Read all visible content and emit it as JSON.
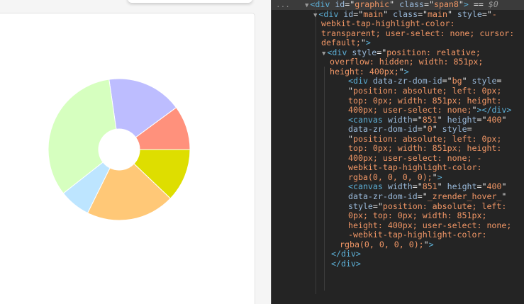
{
  "chart_data": {
    "type": "pie",
    "values": [
      10,
      17,
      33,
      7,
      20,
      12
    ],
    "colors": [
      "#ff917c",
      "#bdbdff",
      "#d6ffbf",
      "#bde5ff",
      "#ffc877",
      "#dede00"
    ],
    "inner_radius_ratio": 0.29,
    "start_angle_deg": 0,
    "direction": "counterclockwise"
  },
  "devtools": {
    "dots": "...",
    "lines": [
      {
        "name": "dt-line-graphic",
        "arrow": "▼",
        "parts": [
          {
            "c": "tag",
            "t": "<div "
          },
          {
            "c": "an",
            "t": "id"
          },
          {
            "c": "eq",
            "t": "=\""
          },
          {
            "c": "av",
            "t": "graphic"
          },
          {
            "c": "eq",
            "t": "\" "
          },
          {
            "c": "an",
            "t": "class"
          },
          {
            "c": "eq",
            "t": "=\""
          },
          {
            "c": "av",
            "t": "span8"
          },
          {
            "c": "eq",
            "t": "\""
          },
          {
            "c": "tag",
            "t": ">"
          },
          {
            "c": "tx",
            "t": " == "
          },
          {
            "c": "sel",
            "t": "$0"
          }
        ]
      },
      {
        "name": "dt-line-main-1",
        "arrow": "▼",
        "parts": [
          {
            "c": "tag",
            "t": "<div "
          },
          {
            "c": "an",
            "t": "id"
          },
          {
            "c": "eq",
            "t": "=\""
          },
          {
            "c": "av",
            "t": "main"
          },
          {
            "c": "eq",
            "t": "\" "
          },
          {
            "c": "an",
            "t": "class"
          },
          {
            "c": "eq",
            "t": "=\""
          },
          {
            "c": "av",
            "t": "main"
          },
          {
            "c": "eq",
            "t": "\" "
          },
          {
            "c": "an",
            "t": "style"
          },
          {
            "c": "eq",
            "t": "=\""
          },
          {
            "c": "av",
            "t": "-"
          }
        ]
      },
      {
        "name": "dt-line-main-2",
        "arrow": "",
        "parts": [
          {
            "c": "av",
            "t": "webkit-tap-highlight-color:"
          }
        ]
      },
      {
        "name": "dt-line-main-3",
        "arrow": "",
        "parts": [
          {
            "c": "av",
            "t": "transparent; user-select: none; cursor:"
          }
        ]
      },
      {
        "name": "dt-line-main-4",
        "arrow": "",
        "parts": [
          {
            "c": "av",
            "t": "default;"
          },
          {
            "c": "eq",
            "t": "\""
          },
          {
            "c": "tag",
            "t": ">"
          }
        ]
      },
      {
        "name": "dt-line-rel-1",
        "arrow": "▼",
        "parts": [
          {
            "c": "tag",
            "t": "<div "
          },
          {
            "c": "an",
            "t": "style"
          },
          {
            "c": "eq",
            "t": "=\""
          },
          {
            "c": "av",
            "t": "position: relative;"
          }
        ]
      },
      {
        "name": "dt-line-rel-2",
        "arrow": "",
        "parts": [
          {
            "c": "av",
            "t": "overflow: hidden; width: 851px;"
          }
        ]
      },
      {
        "name": "dt-line-rel-3",
        "arrow": "",
        "parts": [
          {
            "c": "av",
            "t": "height: 400px;"
          },
          {
            "c": "eq",
            "t": "\""
          },
          {
            "c": "tag",
            "t": ">"
          }
        ]
      },
      {
        "name": "dt-line-bg-1",
        "arrow": "",
        "parts": [
          {
            "c": "tag",
            "t": "<div "
          },
          {
            "c": "an",
            "t": "data-zr-dom-id"
          },
          {
            "c": "eq",
            "t": "=\""
          },
          {
            "c": "av",
            "t": "bg"
          },
          {
            "c": "eq",
            "t": "\" "
          },
          {
            "c": "an",
            "t": "style"
          },
          {
            "c": "eq",
            "t": "="
          }
        ]
      },
      {
        "name": "dt-line-bg-2",
        "arrow": "",
        "parts": [
          {
            "c": "eq",
            "t": "\""
          },
          {
            "c": "av",
            "t": "position: absolute; left: 0px;"
          }
        ]
      },
      {
        "name": "dt-line-bg-3",
        "arrow": "",
        "parts": [
          {
            "c": "av",
            "t": "top: 0px; width: 851px; height:"
          }
        ]
      },
      {
        "name": "dt-line-bg-4",
        "arrow": "",
        "parts": [
          {
            "c": "av",
            "t": "400px; user-select: none;"
          },
          {
            "c": "eq",
            "t": "\""
          },
          {
            "c": "tag",
            "t": "></div>"
          }
        ]
      },
      {
        "name": "dt-line-c0-1",
        "arrow": "",
        "parts": [
          {
            "c": "tag",
            "t": "<canvas "
          },
          {
            "c": "an",
            "t": "width"
          },
          {
            "c": "eq",
            "t": "=\""
          },
          {
            "c": "av",
            "t": "851"
          },
          {
            "c": "eq",
            "t": "\" "
          },
          {
            "c": "an",
            "t": "height"
          },
          {
            "c": "eq",
            "t": "=\""
          },
          {
            "c": "av",
            "t": "400"
          },
          {
            "c": "eq",
            "t": "\""
          }
        ]
      },
      {
        "name": "dt-line-c0-2",
        "arrow": "",
        "parts": [
          {
            "c": "an",
            "t": "data-zr-dom-id"
          },
          {
            "c": "eq",
            "t": "=\""
          },
          {
            "c": "av",
            "t": "0"
          },
          {
            "c": "eq",
            "t": "\" "
          },
          {
            "c": "an",
            "t": "style"
          },
          {
            "c": "eq",
            "t": "="
          }
        ]
      },
      {
        "name": "dt-line-c0-3",
        "arrow": "",
        "parts": [
          {
            "c": "eq",
            "t": "\""
          },
          {
            "c": "av",
            "t": "position: absolute; left: 0px;"
          }
        ]
      },
      {
        "name": "dt-line-c0-4",
        "arrow": "",
        "parts": [
          {
            "c": "av",
            "t": "top: 0px; width: 851px; height:"
          }
        ]
      },
      {
        "name": "dt-line-c0-5",
        "arrow": "",
        "parts": [
          {
            "c": "av",
            "t": "400px; user-select: none; -"
          }
        ]
      },
      {
        "name": "dt-line-c0-6",
        "arrow": "",
        "parts": [
          {
            "c": "av",
            "t": "webkit-tap-highlight-color:"
          }
        ]
      },
      {
        "name": "dt-line-c0-7",
        "arrow": "",
        "parts": [
          {
            "c": "av",
            "t": "rgba(0, 0, 0, 0);"
          },
          {
            "c": "eq",
            "t": "\""
          },
          {
            "c": "tag",
            "t": ">"
          }
        ]
      },
      {
        "name": "dt-line-c1-1",
        "arrow": "",
        "parts": [
          {
            "c": "tag",
            "t": "<canvas "
          },
          {
            "c": "an",
            "t": "width"
          },
          {
            "c": "eq",
            "t": "=\""
          },
          {
            "c": "av",
            "t": "851"
          },
          {
            "c": "eq",
            "t": "\" "
          },
          {
            "c": "an",
            "t": "height"
          },
          {
            "c": "eq",
            "t": "=\""
          },
          {
            "c": "av",
            "t": "400"
          },
          {
            "c": "eq",
            "t": "\""
          }
        ]
      },
      {
        "name": "dt-line-c1-2",
        "arrow": "",
        "parts": [
          {
            "c": "an",
            "t": "data-zr-dom-id"
          },
          {
            "c": "eq",
            "t": "=\""
          },
          {
            "c": "av",
            "t": "_zrender_hover_"
          },
          {
            "c": "eq",
            "t": "\""
          }
        ]
      },
      {
        "name": "dt-line-c1-3",
        "arrow": "",
        "parts": [
          {
            "c": "an",
            "t": "style"
          },
          {
            "c": "eq",
            "t": "=\""
          },
          {
            "c": "av",
            "t": "position: absolute; left:"
          }
        ]
      },
      {
        "name": "dt-line-c1-4",
        "arrow": "",
        "parts": [
          {
            "c": "av",
            "t": "0px; top: 0px; width: 851px;"
          }
        ]
      },
      {
        "name": "dt-line-c1-5",
        "arrow": "",
        "parts": [
          {
            "c": "av",
            "t": "height: 400px; user-select: none;"
          }
        ]
      },
      {
        "name": "dt-line-c1-6",
        "arrow": "",
        "parts": [
          {
            "c": "av",
            "t": "-webkit-tap-highlight-color:"
          }
        ]
      },
      {
        "name": "dt-line-c1-7",
        "arrow": "",
        "parts": [
          {
            "c": "av",
            "t": "rgba(0, 0, 0, 0);"
          },
          {
            "c": "eq",
            "t": "\""
          },
          {
            "c": "tag",
            "t": ">"
          }
        ]
      },
      {
        "name": "dt-line-close-rel",
        "arrow": "",
        "parts": [
          {
            "c": "tag",
            "t": "</div>"
          }
        ]
      },
      {
        "name": "dt-line-close-main",
        "arrow": "",
        "parts": [
          {
            "c": "tag",
            "t": "</div>"
          }
        ]
      }
    ]
  }
}
